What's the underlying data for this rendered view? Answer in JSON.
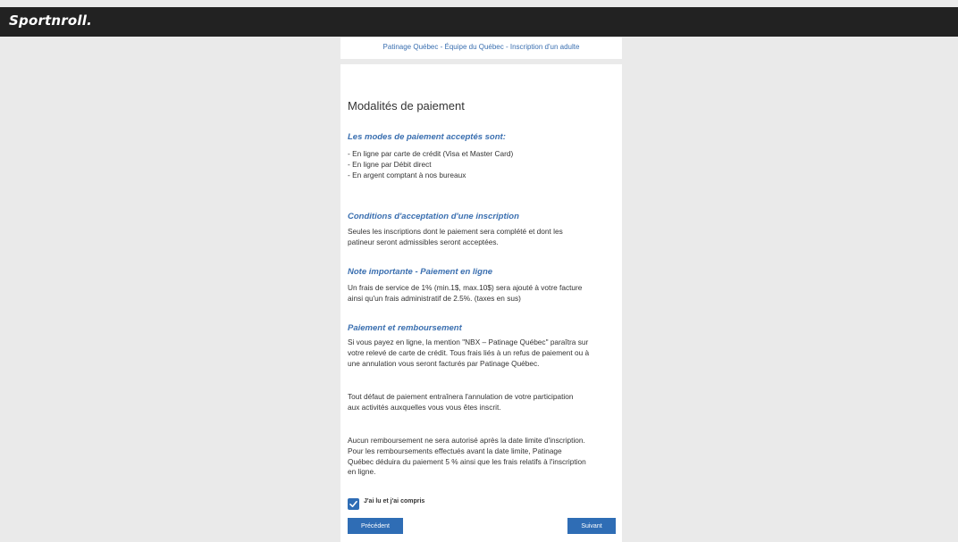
{
  "header": {
    "logo_text": "Sportnroll",
    "logo_dot": "."
  },
  "page": {
    "subtitle": "Patinage Québec - Équipe du Québec - Inscription d'un adulte",
    "title": "Modalités de paiement"
  },
  "sections": {
    "modes": {
      "title": "Les modes de paiement acceptés sont:",
      "lines": [
        "- En ligne par carte de crédit (Visa et Master Card)",
        "- En ligne par Débit direct",
        "- En argent comptant à nos bureaux"
      ]
    },
    "conditions": {
      "title": "Conditions d'acceptation d'une inscription",
      "lines": [
        "Seules les inscriptions dont le paiement sera complété et dont les",
        "patineur seront admissibles seront acceptées."
      ]
    },
    "note": {
      "title": "Note importante - Paiement en ligne",
      "lines": [
        "Un frais de service de 1% (min.1$, max.10$) sera ajouté à votre facture",
        "ainsi qu'un frais administratif de 2.5%. (taxes en sus)"
      ]
    },
    "refund": {
      "title": "Paiement et remboursement",
      "para1": [
        "Si vous payez en ligne, la mention \"NBX – Patinage Québec\" paraîtra sur",
        "votre relevé de carte de crédit. Tous frais liés à un refus de paiement ou à",
        "une annulation vous seront facturés par Patinage Québec."
      ],
      "para2": [
        "Tout défaut de paiement entraînera l'annulation de votre participation",
        "aux activités auxquelles vous vous êtes inscrit."
      ],
      "para3": [
        "Aucun remboursement ne sera autorisé après la date limite d'inscription.",
        "Pour les remboursements effectués avant la date limite, Patinage",
        "Québec déduira du paiement 5 % ainsi que les frais relatifs à l'inscription",
        "en ligne."
      ]
    }
  },
  "agreement": {
    "label": "J'ai lu et j'ai compris",
    "checked": true
  },
  "buttons": {
    "previous": "Précédent",
    "next": "Suivant"
  },
  "colors": {
    "accent": "#2f6db5",
    "header_bg": "#222222",
    "section_title": "#3a6fb0",
    "page_bg": "#eaeaea"
  }
}
